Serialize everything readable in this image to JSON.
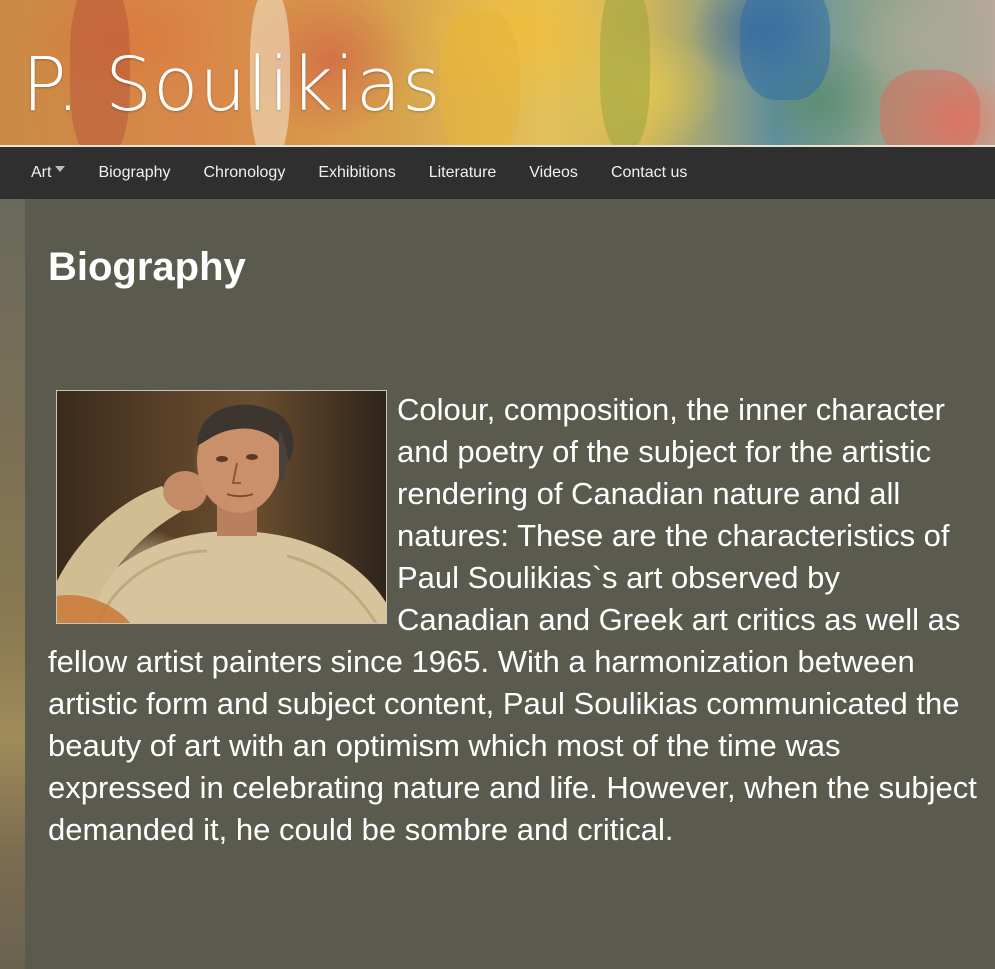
{
  "site": {
    "logo_text": "P. Soulikias"
  },
  "nav": {
    "items": [
      {
        "label": "Art",
        "has_dropdown": true
      },
      {
        "label": "Biography",
        "has_dropdown": false
      },
      {
        "label": "Chronology",
        "has_dropdown": false
      },
      {
        "label": "Exhibitions",
        "has_dropdown": false
      },
      {
        "label": "Literature",
        "has_dropdown": false
      },
      {
        "label": "Videos",
        "has_dropdown": false
      },
      {
        "label": "Contact us",
        "has_dropdown": false
      }
    ]
  },
  "page": {
    "title": "Biography",
    "body": "Colour, composition, the inner character and poetry of the subject for the artistic rendering of Canadian nature and all natures: These are the characteristics of Paul Soulikias`s art observed by Canadian and Greek art critics as well as fellow artist painters since 1965. With a harmonization between artistic form and subject content, Paul Soulikias communicated the beauty of art with an optimism which most of the time was expressed in celebrating nature and life. However, when the subject demanded it, he could be sombre and critical."
  },
  "colors": {
    "content_bg": "#5b5a4f",
    "nav_bg": "#2f2f2f",
    "text": "#ffffff"
  },
  "icons": {
    "dropdown": "caret-down-icon"
  }
}
